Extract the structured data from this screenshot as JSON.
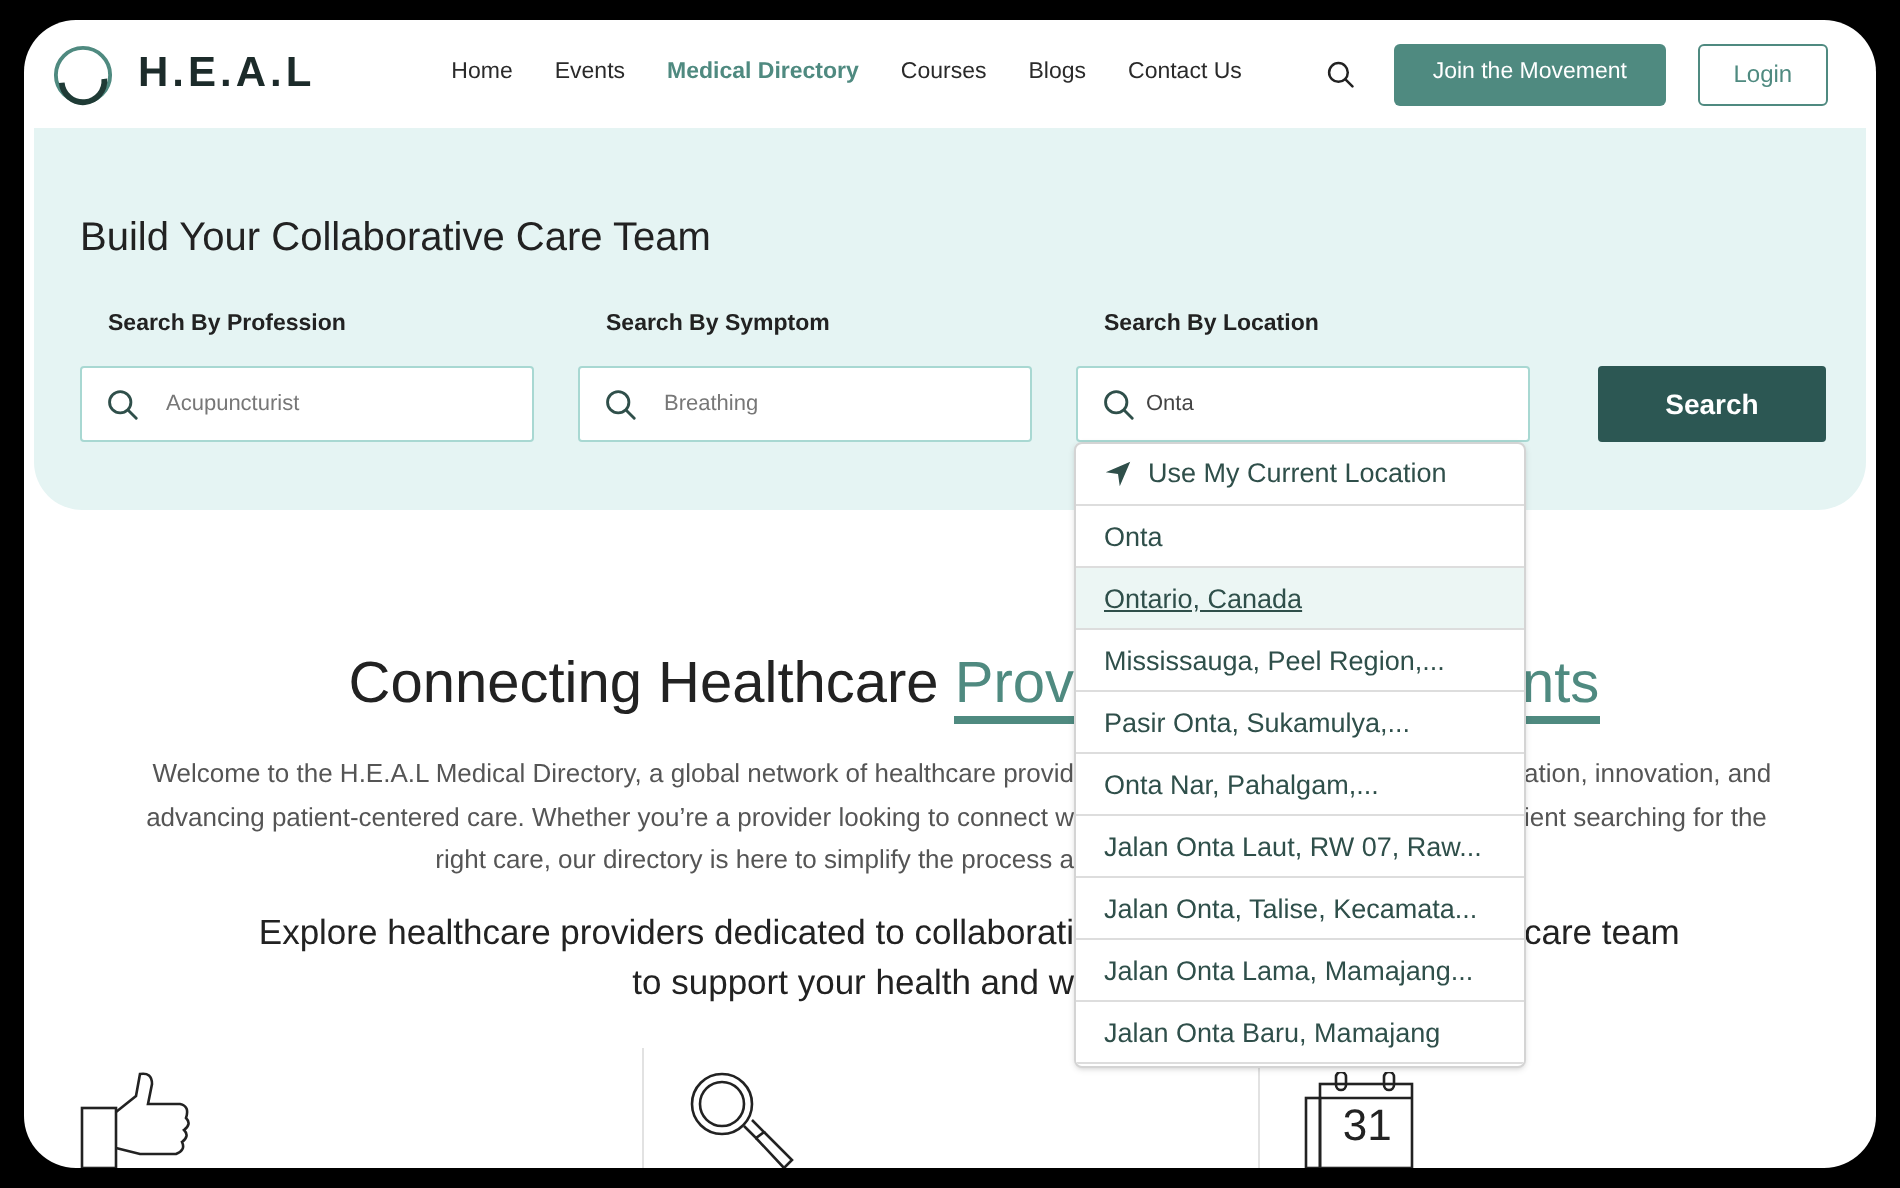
{
  "header": {
    "logo": "H.E.A.L",
    "nav": [
      {
        "label": "Home",
        "selected": false
      },
      {
        "label": "Events",
        "selected": false
      },
      {
        "label": "Medical Directory",
        "selected": true
      },
      {
        "label": "Courses",
        "selected": false
      },
      {
        "label": "Blogs",
        "selected": false
      },
      {
        "label": "Contact Us",
        "selected": false
      }
    ],
    "cta": "Join the Movement",
    "login": "Login"
  },
  "search_panel": {
    "title": "Build Your Collaborative Care Team",
    "fields": [
      {
        "label": "Search By Profession",
        "placeholder": "Acupuncturist"
      },
      {
        "label": "Search By Symptom",
        "placeholder": "Breathing"
      },
      {
        "label": "Search By Location",
        "value": "Onta"
      }
    ],
    "button": "Search"
  },
  "location_dropdown": {
    "current_location": "Use My Current Location",
    "items": [
      {
        "label": "Onta",
        "selected": false
      },
      {
        "label": "Ontario, Canada",
        "selected": true
      },
      {
        "label": "Mississauga, Peel Region,...",
        "selected": false
      },
      {
        "label": "Pasir Onta, Sukamulya,...",
        "selected": false
      },
      {
        "label": "Onta Nar, Pahalgam,...",
        "selected": false
      },
      {
        "label": "Jalan Onta Laut, RW 07, Raw...",
        "selected": false
      },
      {
        "label": "Jalan Onta, Talise, Kecamata...",
        "selected": false
      },
      {
        "label": "Jalan Onta Lama, Mamajang...",
        "selected": false
      },
      {
        "label": "Jalan Onta Baru, Mamajang",
        "selected": false
      }
    ]
  },
  "intro": {
    "heading": {
      "left": "Connecting Healthcare ",
      "left_accent": "Prov",
      "right_accent": "nts"
    },
    "paragraph_lines": [
      {
        "left": "Welcome to the H.E.A.L Medical Directory, a global network of healthcare provid",
        "right": "ation, innovation, and"
      },
      {
        "left": "advancing patient-centered care. Whether you’re a provider looking to connect w",
        "right": "ient searching for the"
      },
      {
        "left": "right care, our directory is here to simplify the process a"
      }
    ],
    "tagline_lines": [
      {
        "left": "Explore healthcare providers dedicated to collaborati",
        "right": "care team"
      },
      {
        "left": "to support your health and w"
      }
    ]
  },
  "features": [
    {
      "kind": "thumbs"
    },
    {
      "kind": "search"
    },
    {
      "kind": "calendar",
      "day": "31"
    }
  ]
}
